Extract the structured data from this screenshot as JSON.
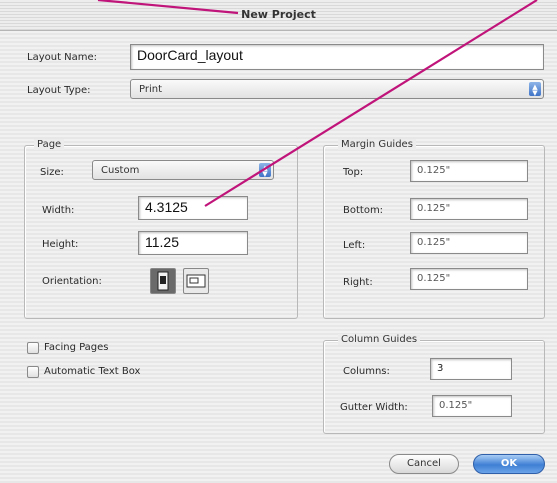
{
  "window": {
    "title": "New Project"
  },
  "layout_name": {
    "label": "Layout Name:",
    "value": "DoorCard_layout"
  },
  "layout_type": {
    "label": "Layout Type:",
    "value": "Print"
  },
  "page": {
    "title": "Page",
    "size_label": "Size:",
    "size_value": "Custom",
    "width_label": "Width:",
    "width_value": "4.3125",
    "height_label": "Height:",
    "height_value": "11.25",
    "orientation_label": "Orientation:"
  },
  "margin_guides": {
    "title": "Margin Guides",
    "top_label": "Top:",
    "top_value": "0.125\"",
    "bottom_label": "Bottom:",
    "bottom_value": "0.125\"",
    "left_label": "Left:",
    "left_value": "0.125\"",
    "right_label": "Right:",
    "right_value": "0.125\""
  },
  "facing_pages": {
    "label": "Facing Pages"
  },
  "automatic_text_box": {
    "label": "Automatic Text Box"
  },
  "column_guides": {
    "title": "Column Guides",
    "columns_label": "Columns:",
    "columns_value": "3",
    "gutter_label": "Gutter Width:",
    "gutter_value": "0.125\""
  },
  "buttons": {
    "cancel": "Cancel",
    "ok": "OK"
  },
  "annotation": {
    "color": "#c0147a"
  }
}
